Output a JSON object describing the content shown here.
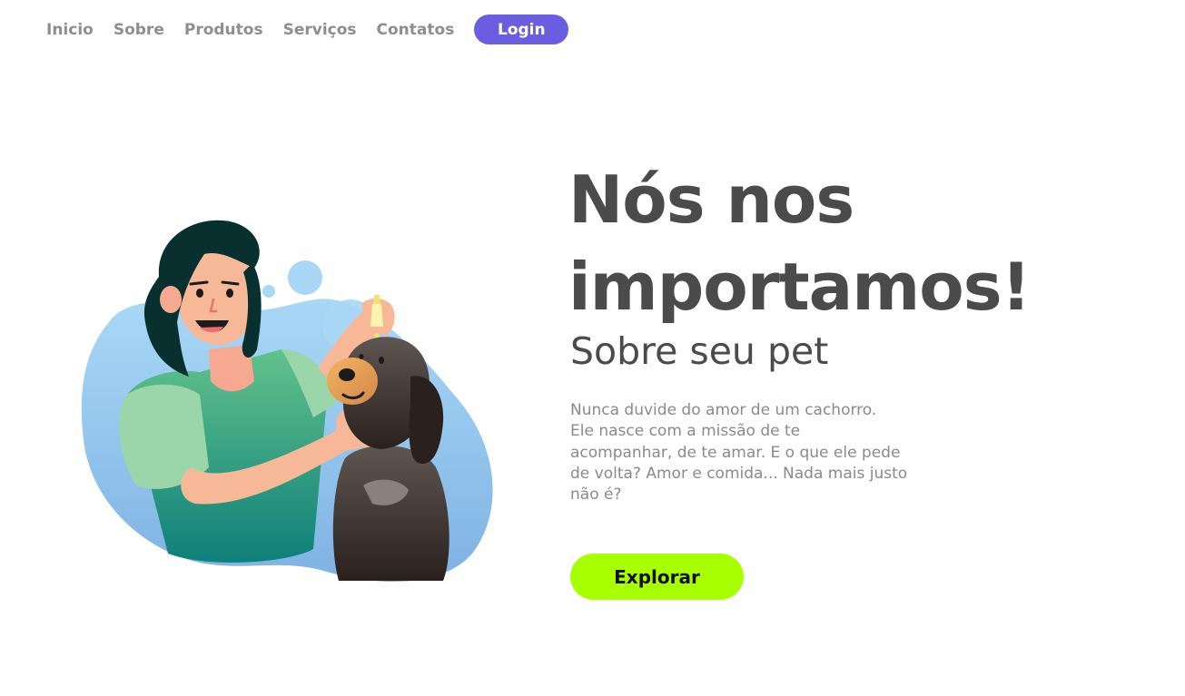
{
  "nav": {
    "items": [
      {
        "label": "Inicio"
      },
      {
        "label": "Sobre"
      },
      {
        "label": "Produtos"
      },
      {
        "label": "Serviços"
      },
      {
        "label": "Contatos"
      }
    ],
    "login_label": "Login"
  },
  "hero": {
    "title_line1": "Nós nos",
    "title_line2": "importamos!",
    "subtitle": "Sobre seu pet",
    "description_lines": [
      "Nunca duvide do amor de um cachorro.",
      "Ele nasce com a missão de te",
      "acompanhar, de te amar. E o que ele pede",
      "de volta? Amor e comida... Nada mais justo",
      "não é?"
    ],
    "cta_label": "Explorar"
  },
  "colors": {
    "accent_login": "#6a5de0",
    "accent_cta": "#a8ff00",
    "heading": "#4b4b4b",
    "nav_text": "#8e8e8e"
  },
  "illustration": {
    "icon": "woman-giving-eye-drops-to-dog-illustration"
  }
}
